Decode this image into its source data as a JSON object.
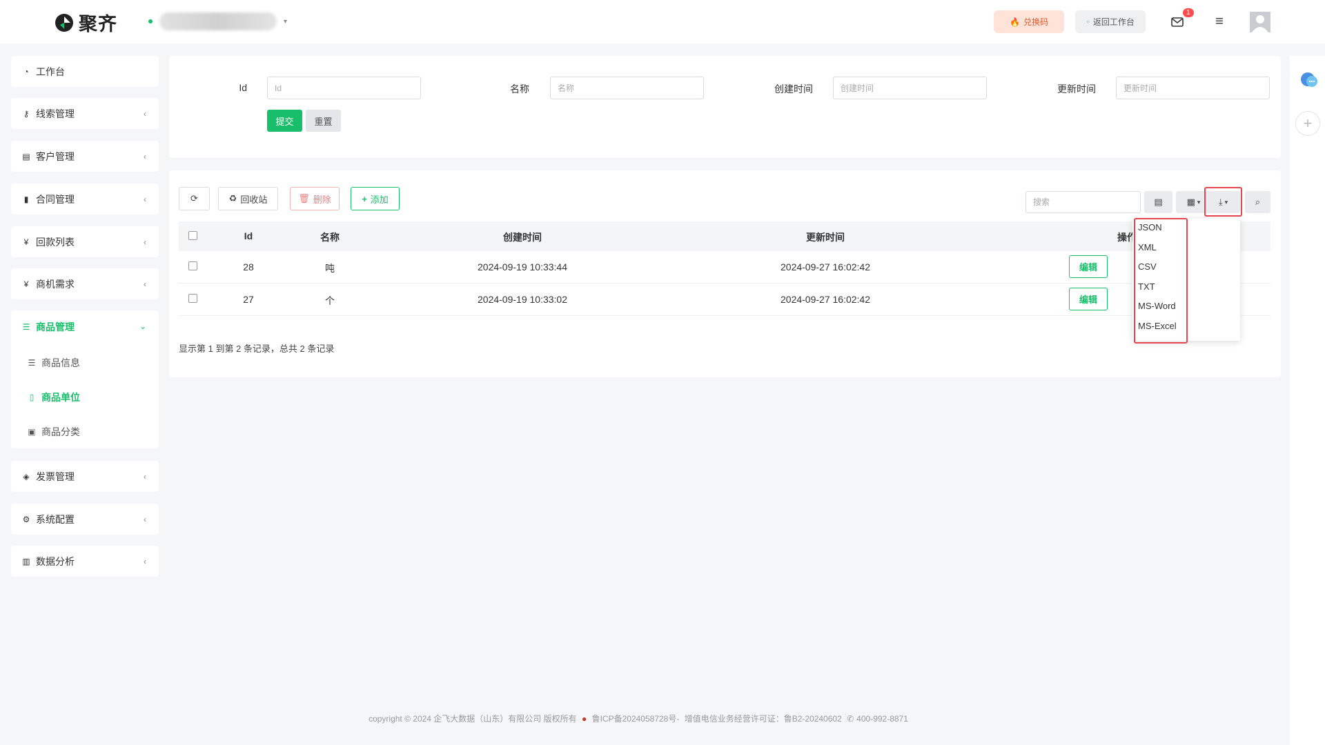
{
  "header": {
    "logo_text": "聚齐",
    "redeem_label": "兑换码",
    "back_label": "返回工作台",
    "mail_badge": "1"
  },
  "sidebar": {
    "items": [
      {
        "label": "工作台",
        "icon": "dashboard-icon"
      },
      {
        "label": "线索管理",
        "icon": "key-icon"
      },
      {
        "label": "客户管理",
        "icon": "id-card-icon"
      },
      {
        "label": "合同管理",
        "icon": "bookmark-icon"
      },
      {
        "label": "回款列表",
        "icon": "yen-icon"
      },
      {
        "label": "商机需求",
        "icon": "yen-icon"
      }
    ],
    "group": {
      "label": "商品管理",
      "sub": [
        {
          "label": "商品信息",
          "icon": "list-icon"
        },
        {
          "label": "商品单位",
          "icon": "document-icon"
        },
        {
          "label": "商品分类",
          "icon": "calendar-icon"
        }
      ]
    },
    "items_bottom": [
      {
        "label": "发票管理",
        "icon": "tag-icon"
      },
      {
        "label": "系统配置",
        "icon": "gears-icon"
      },
      {
        "label": "数据分析",
        "icon": "bar-chart-icon"
      }
    ]
  },
  "filter": {
    "fields": [
      {
        "label": "Id",
        "placeholder": "Id"
      },
      {
        "label": "名称",
        "placeholder": "名称"
      },
      {
        "label": "创建时间",
        "placeholder": "创建时间"
      },
      {
        "label": "更新时间",
        "placeholder": "更新时间"
      }
    ],
    "submit": "提交",
    "reset": "重置"
  },
  "toolbar": {
    "recycle": "回收站",
    "delete": "删除",
    "add": "添加",
    "search_placeholder": "搜索"
  },
  "table": {
    "columns": [
      "Id",
      "名称",
      "创建时间",
      "更新时间",
      "操作"
    ],
    "rows": [
      {
        "id": "28",
        "name": "吨",
        "created": "2024-09-19 10:33:44",
        "updated": "2024-09-27 16:02:42",
        "edit": "编辑"
      },
      {
        "id": "27",
        "name": "个",
        "created": "2024-09-19 10:33:02",
        "updated": "2024-09-27 16:02:42",
        "edit": "编辑"
      }
    ],
    "summary": "显示第 1 到第 2 条记录，总共 2 条记录"
  },
  "export_menu": [
    "JSON",
    "XML",
    "CSV",
    "TXT",
    "MS-Word",
    "MS-Excel"
  ],
  "footer": {
    "copyright": "copyright © 2024 企飞大数据（山东）有限公司 版权所有",
    "icp": "鲁ICP备2024058728号-",
    "license": "增值电信业务经营许可证：鲁B2-20240602",
    "phone": "400-992-8871"
  },
  "colors": {
    "accent": "#19be6b",
    "danger": "#e8454f"
  }
}
